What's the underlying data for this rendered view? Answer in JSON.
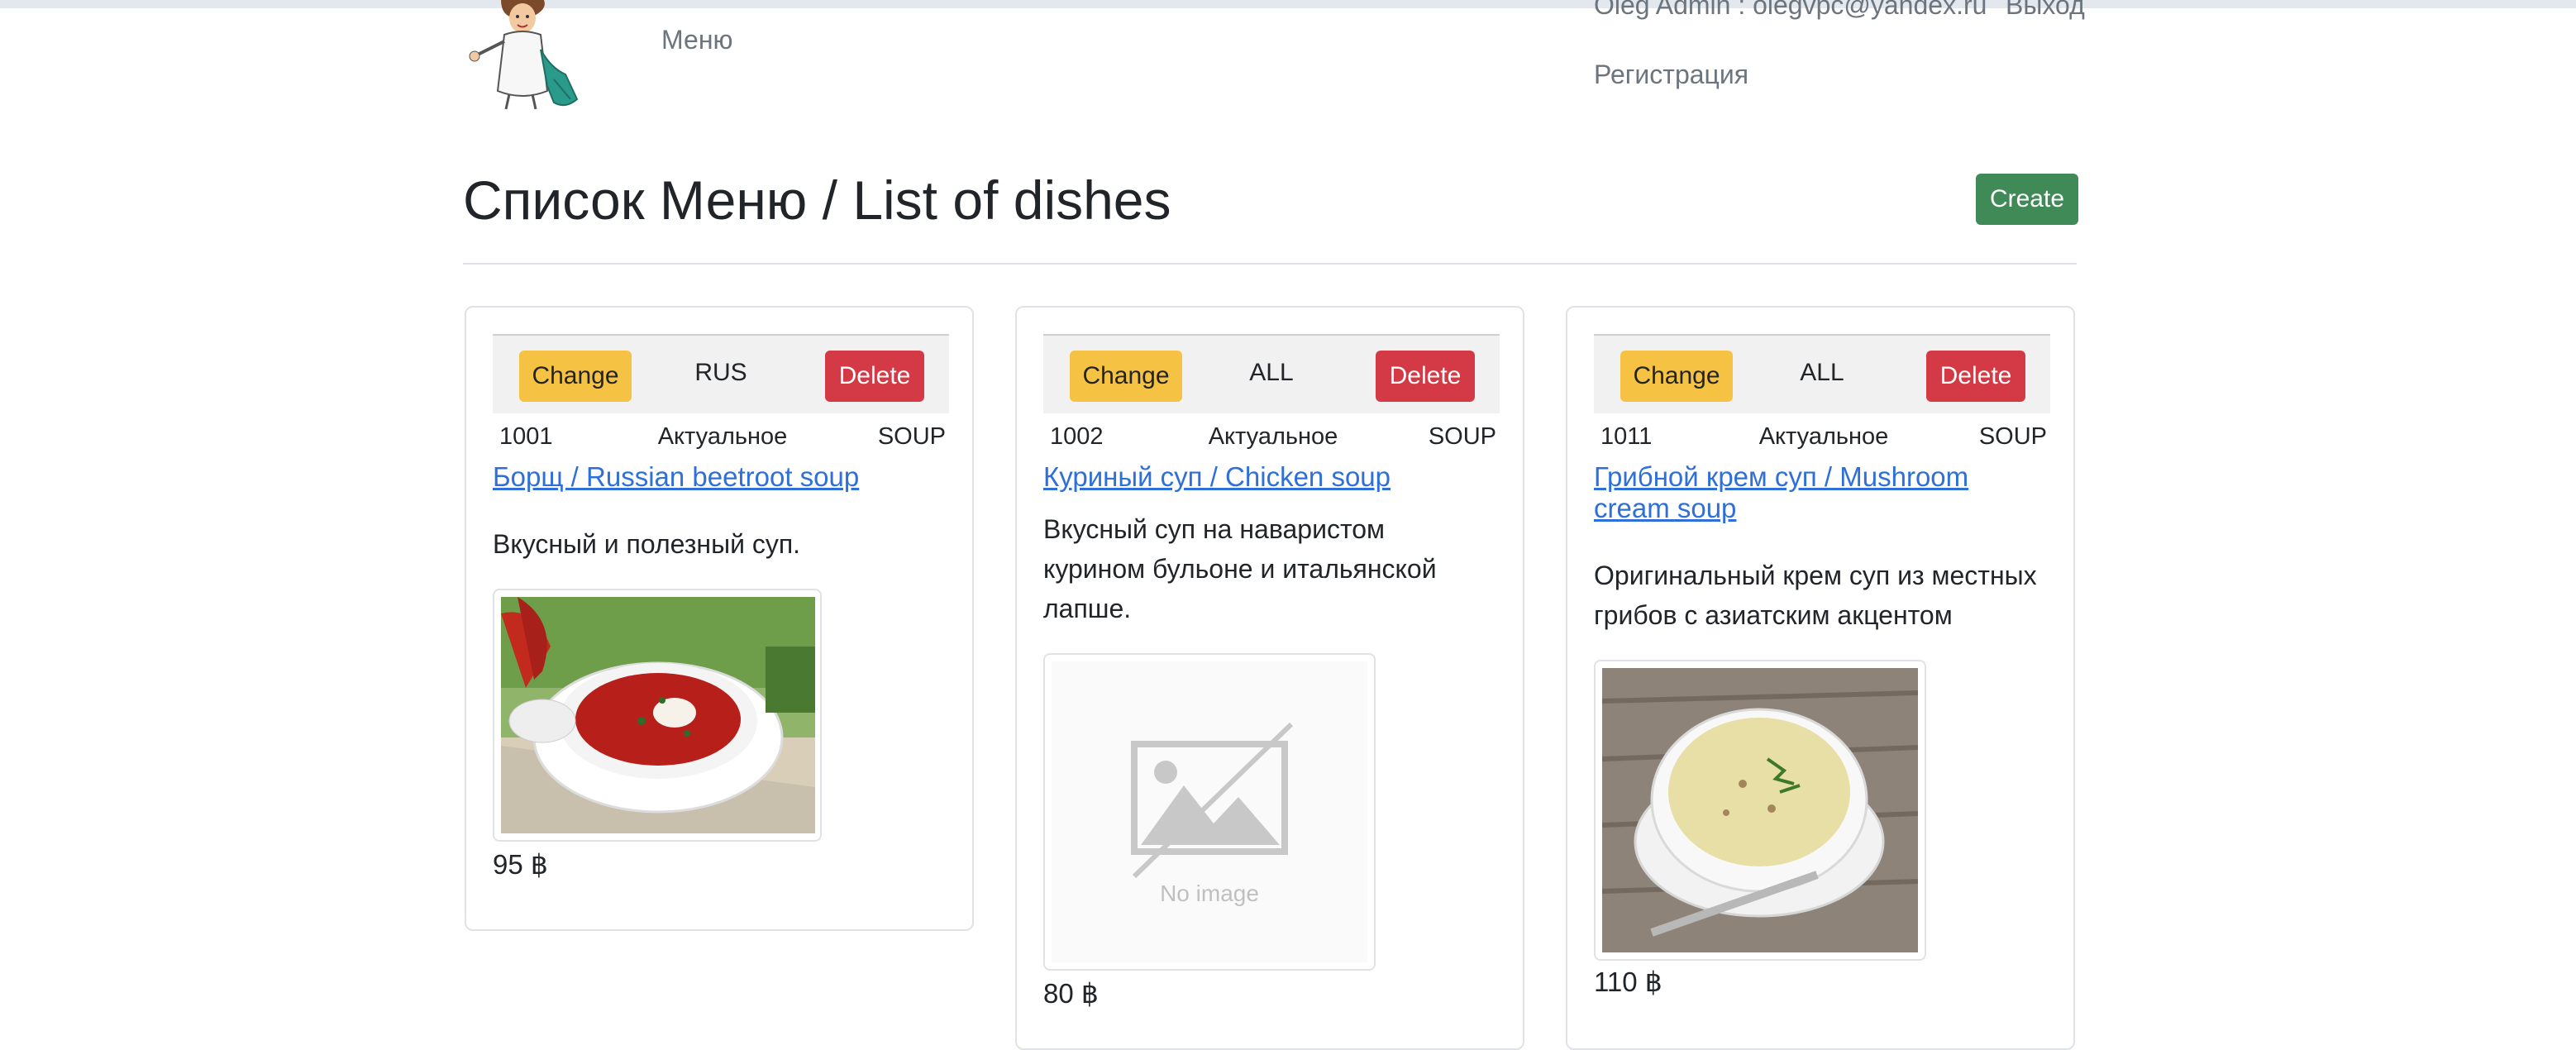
{
  "header": {
    "nav_menu": "Меню",
    "user_info": "Oleg Admin : olegvpc@yandex.ru",
    "logout": "Выход",
    "register": "Регистрация"
  },
  "page": {
    "title": "Список Меню / List of dishes",
    "create_label": "Create"
  },
  "cards": [
    {
      "change_label": "Change",
      "region": "RUS",
      "delete_label": "Delete",
      "id": "1001",
      "status": "Актуальное",
      "type": "SOUP",
      "name": "Борщ / Russian beetroot soup",
      "description": "Вкусный и полезный суп.",
      "image": "borscht-photo",
      "price": "95 ฿"
    },
    {
      "change_label": "Change",
      "region": "ALL",
      "delete_label": "Delete",
      "id": "1002",
      "status": "Актуальное",
      "type": "SOUP",
      "name": "Куриный суп / Chicken soup",
      "description": "Вкусный суп на наваристом курином бульоне и итальянской лапше.",
      "image": "no-image-placeholder",
      "no_image_text": "No image",
      "price": "80 ฿"
    },
    {
      "change_label": "Change",
      "region": "ALL",
      "delete_label": "Delete",
      "id": "1011",
      "status": "Актуальное",
      "type": "SOUP",
      "name": "Грибной крем суп / Mushroom cream soup",
      "description": "Оригинальный крем суп из местных грибов с азиатским акцентом",
      "image": "mushroom-soup-photo",
      "price": "110 ฿"
    }
  ],
  "colors": {
    "create": "#3f8a56",
    "change": "#f5c243",
    "delete": "#d43a45",
    "link": "#2e6fd8"
  }
}
